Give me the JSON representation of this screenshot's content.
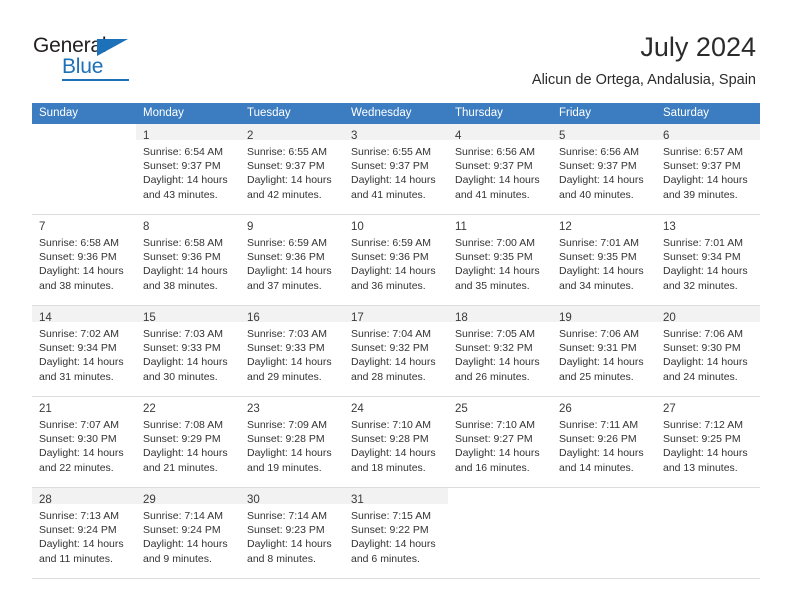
{
  "brand": {
    "name_part1": "General",
    "name_part2": "Blue",
    "triangle_icon": "triangle-icon",
    "accent_color": "#1d71b8"
  },
  "header": {
    "title": "July 2024",
    "subtitle": "Alicun de Ortega, Andalusia, Spain"
  },
  "calendar": {
    "header_bg": "#3b7dc0",
    "weekdays": [
      "Sunday",
      "Monday",
      "Tuesday",
      "Wednesday",
      "Thursday",
      "Friday",
      "Saturday"
    ],
    "weeks": [
      [
        {
          "day": "",
          "lines": []
        },
        {
          "day": "1",
          "lines": [
            "Sunrise: 6:54 AM",
            "Sunset: 9:37 PM",
            "Daylight: 14 hours",
            "and 43 minutes."
          ]
        },
        {
          "day": "2",
          "lines": [
            "Sunrise: 6:55 AM",
            "Sunset: 9:37 PM",
            "Daylight: 14 hours",
            "and 42 minutes."
          ]
        },
        {
          "day": "3",
          "lines": [
            "Sunrise: 6:55 AM",
            "Sunset: 9:37 PM",
            "Daylight: 14 hours",
            "and 41 minutes."
          ]
        },
        {
          "day": "4",
          "lines": [
            "Sunrise: 6:56 AM",
            "Sunset: 9:37 PM",
            "Daylight: 14 hours",
            "and 41 minutes."
          ]
        },
        {
          "day": "5",
          "lines": [
            "Sunrise: 6:56 AM",
            "Sunset: 9:37 PM",
            "Daylight: 14 hours",
            "and 40 minutes."
          ]
        },
        {
          "day": "6",
          "lines": [
            "Sunrise: 6:57 AM",
            "Sunset: 9:37 PM",
            "Daylight: 14 hours",
            "and 39 minutes."
          ]
        }
      ],
      [
        {
          "day": "7",
          "lines": [
            "Sunrise: 6:58 AM",
            "Sunset: 9:36 PM",
            "Daylight: 14 hours",
            "and 38 minutes."
          ]
        },
        {
          "day": "8",
          "lines": [
            "Sunrise: 6:58 AM",
            "Sunset: 9:36 PM",
            "Daylight: 14 hours",
            "and 38 minutes."
          ]
        },
        {
          "day": "9",
          "lines": [
            "Sunrise: 6:59 AM",
            "Sunset: 9:36 PM",
            "Daylight: 14 hours",
            "and 37 minutes."
          ]
        },
        {
          "day": "10",
          "lines": [
            "Sunrise: 6:59 AM",
            "Sunset: 9:36 PM",
            "Daylight: 14 hours",
            "and 36 minutes."
          ]
        },
        {
          "day": "11",
          "lines": [
            "Sunrise: 7:00 AM",
            "Sunset: 9:35 PM",
            "Daylight: 14 hours",
            "and 35 minutes."
          ]
        },
        {
          "day": "12",
          "lines": [
            "Sunrise: 7:01 AM",
            "Sunset: 9:35 PM",
            "Daylight: 14 hours",
            "and 34 minutes."
          ]
        },
        {
          "day": "13",
          "lines": [
            "Sunrise: 7:01 AM",
            "Sunset: 9:34 PM",
            "Daylight: 14 hours",
            "and 32 minutes."
          ]
        }
      ],
      [
        {
          "day": "14",
          "lines": [
            "Sunrise: 7:02 AM",
            "Sunset: 9:34 PM",
            "Daylight: 14 hours",
            "and 31 minutes."
          ]
        },
        {
          "day": "15",
          "lines": [
            "Sunrise: 7:03 AM",
            "Sunset: 9:33 PM",
            "Daylight: 14 hours",
            "and 30 minutes."
          ]
        },
        {
          "day": "16",
          "lines": [
            "Sunrise: 7:03 AM",
            "Sunset: 9:33 PM",
            "Daylight: 14 hours",
            "and 29 minutes."
          ]
        },
        {
          "day": "17",
          "lines": [
            "Sunrise: 7:04 AM",
            "Sunset: 9:32 PM",
            "Daylight: 14 hours",
            "and 28 minutes."
          ]
        },
        {
          "day": "18",
          "lines": [
            "Sunrise: 7:05 AM",
            "Sunset: 9:32 PM",
            "Daylight: 14 hours",
            "and 26 minutes."
          ]
        },
        {
          "day": "19",
          "lines": [
            "Sunrise: 7:06 AM",
            "Sunset: 9:31 PM",
            "Daylight: 14 hours",
            "and 25 minutes."
          ]
        },
        {
          "day": "20",
          "lines": [
            "Sunrise: 7:06 AM",
            "Sunset: 9:30 PM",
            "Daylight: 14 hours",
            "and 24 minutes."
          ]
        }
      ],
      [
        {
          "day": "21",
          "lines": [
            "Sunrise: 7:07 AM",
            "Sunset: 9:30 PM",
            "Daylight: 14 hours",
            "and 22 minutes."
          ]
        },
        {
          "day": "22",
          "lines": [
            "Sunrise: 7:08 AM",
            "Sunset: 9:29 PM",
            "Daylight: 14 hours",
            "and 21 minutes."
          ]
        },
        {
          "day": "23",
          "lines": [
            "Sunrise: 7:09 AM",
            "Sunset: 9:28 PM",
            "Daylight: 14 hours",
            "and 19 minutes."
          ]
        },
        {
          "day": "24",
          "lines": [
            "Sunrise: 7:10 AM",
            "Sunset: 9:28 PM",
            "Daylight: 14 hours",
            "and 18 minutes."
          ]
        },
        {
          "day": "25",
          "lines": [
            "Sunrise: 7:10 AM",
            "Sunset: 9:27 PM",
            "Daylight: 14 hours",
            "and 16 minutes."
          ]
        },
        {
          "day": "26",
          "lines": [
            "Sunrise: 7:11 AM",
            "Sunset: 9:26 PM",
            "Daylight: 14 hours",
            "and 14 minutes."
          ]
        },
        {
          "day": "27",
          "lines": [
            "Sunrise: 7:12 AM",
            "Sunset: 9:25 PM",
            "Daylight: 14 hours",
            "and 13 minutes."
          ]
        }
      ],
      [
        {
          "day": "28",
          "lines": [
            "Sunrise: 7:13 AM",
            "Sunset: 9:24 PM",
            "Daylight: 14 hours",
            "and 11 minutes."
          ]
        },
        {
          "day": "29",
          "lines": [
            "Sunrise: 7:14 AM",
            "Sunset: 9:24 PM",
            "Daylight: 14 hours",
            "and 9 minutes."
          ]
        },
        {
          "day": "30",
          "lines": [
            "Sunrise: 7:14 AM",
            "Sunset: 9:23 PM",
            "Daylight: 14 hours",
            "and 8 minutes."
          ]
        },
        {
          "day": "31",
          "lines": [
            "Sunrise: 7:15 AM",
            "Sunset: 9:22 PM",
            "Daylight: 14 hours",
            "and 6 minutes."
          ]
        },
        {
          "day": "",
          "lines": []
        },
        {
          "day": "",
          "lines": []
        },
        {
          "day": "",
          "lines": []
        }
      ]
    ]
  }
}
